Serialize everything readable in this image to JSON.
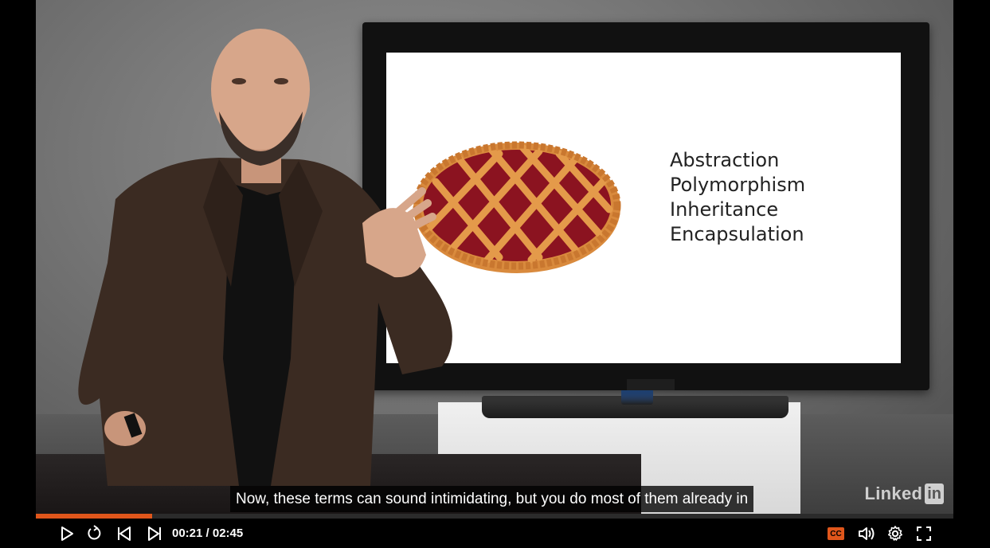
{
  "slide": {
    "terms": [
      "Abstraction",
      "Polymorphism",
      "Inheritance",
      "Encapsulation"
    ]
  },
  "caption": {
    "text": "Now, these terms can sound intimidating, but you do most of them already in"
  },
  "watermark": {
    "word": "Linked",
    "box": "in"
  },
  "player": {
    "time_display": "00:21 / 02:45",
    "progress_fraction": 0.127,
    "cc_label": "CC",
    "accent_color": "#e0561b",
    "icons": {
      "play": "play-icon",
      "replay": "replay-icon",
      "previous": "previous-icon",
      "next": "next-icon",
      "captions": "captions-icon",
      "volume": "volume-icon",
      "settings": "gear-icon",
      "fullscreen": "fullscreen-icon"
    }
  }
}
